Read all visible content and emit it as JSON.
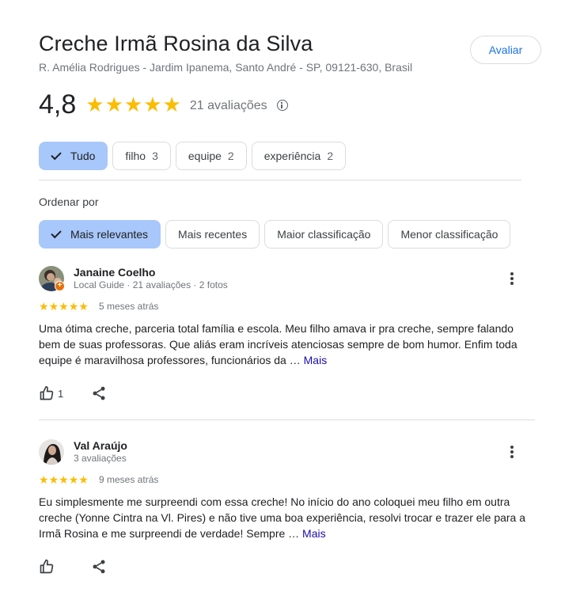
{
  "place": {
    "title": "Creche Irmã Rosina da Silva",
    "address": "R. Amélia Rodrigues - Jardim Ipanema, Santo André - SP, 09121-630, Brasil",
    "rate_button": "Avaliar"
  },
  "summary": {
    "score": "4,8",
    "stars": 5,
    "count_label": "21 avaliações",
    "star_color": "#fbbc04"
  },
  "topics": [
    {
      "label": "Tudo",
      "count": "",
      "selected": true
    },
    {
      "label": "filho",
      "count": "3",
      "selected": false
    },
    {
      "label": "equipe",
      "count": "2",
      "selected": false
    },
    {
      "label": "experiência",
      "count": "2",
      "selected": false
    }
  ],
  "sort": {
    "label": "Ordenar por",
    "options": [
      {
        "label": "Mais relevantes",
        "selected": true
      },
      {
        "label": "Mais recentes",
        "selected": false
      },
      {
        "label": "Maior classificação",
        "selected": false
      },
      {
        "label": "Menor classificação",
        "selected": false
      }
    ]
  },
  "reviews": [
    {
      "name": "Janaine Coelho",
      "meta": "Local Guide · 21 avaliações · 2 fotos",
      "stars": 5,
      "date": "5 meses atrás",
      "text": "Uma ótima creche, parceria total família e escola. Meu filho amava ir pra creche, sempre falando bem de suas professoras. Que aliás eram incríveis atenciosas sempre de bom humor. Enfim toda equipe é maravilhosa professores, funcionários da … ",
      "more": "Mais",
      "likes": "1",
      "local_guide": true
    },
    {
      "name": "Val Araújo",
      "meta": "3 avaliações",
      "stars": 5,
      "date": "9 meses atrás",
      "text": "Eu simplesmente me surpreendi com essa creche! No início do ano coloquei meu filho em outra creche (Yonne Cintra na Vl. Pires) e não tive uma boa experiência, resolvi trocar e trazer ele para a Irmã Rosina e me surpreendi de verdade! Sempre … ",
      "more": "Mais",
      "likes": "",
      "local_guide": false
    }
  ],
  "colors": {
    "accent": "#1a73e8",
    "chip_selected": "#a8c7fa",
    "link": "#1a0dab"
  }
}
